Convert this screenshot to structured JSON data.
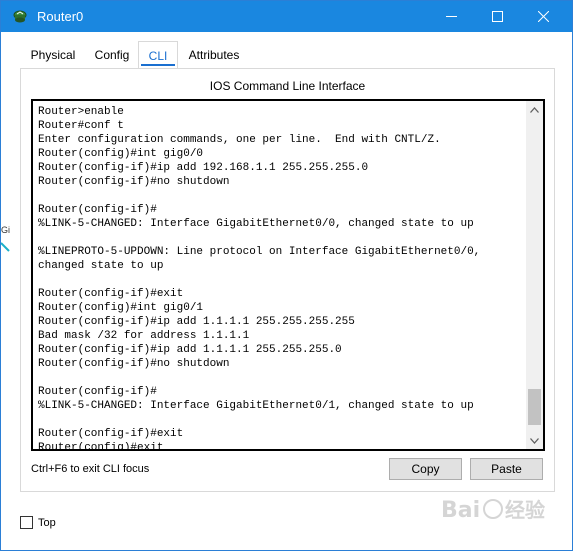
{
  "window": {
    "title": "Router0"
  },
  "tabs": [
    {
      "label": "Physical"
    },
    {
      "label": "Config"
    },
    {
      "label": "CLI"
    },
    {
      "label": "Attributes"
    }
  ],
  "panel": {
    "title": "IOS Command Line Interface"
  },
  "terminal": {
    "lines": [
      "Router>enable",
      "Router#conf t",
      "Enter configuration commands, one per line.  End with CNTL/Z.",
      "Router(config)#int gig0/0",
      "Router(config-if)#ip add 192.168.1.1 255.255.255.0",
      "Router(config-if)#no shutdown",
      "",
      "Router(config-if)#",
      "%LINK-5-CHANGED: Interface GigabitEthernet0/0, changed state to up",
      "",
      "%LINEPROTO-5-UPDOWN: Line protocol on Interface GigabitEthernet0/0,",
      "changed state to up",
      "",
      "Router(config-if)#exit",
      "Router(config)#int gig0/1",
      "Router(config-if)#ip add 1.1.1.1 255.255.255.255",
      "Bad mask /32 for address 1.1.1.1",
      "Router(config-if)#ip add 1.1.1.1 255.255.255.0",
      "Router(config-if)#no shutdown",
      "",
      "Router(config-if)#",
      "%LINK-5-CHANGED: Interface GigabitEthernet0/1, changed state to up",
      "",
      "Router(config-if)#exit",
      "Router(config)#exit"
    ]
  },
  "footer": {
    "hint": "Ctrl+F6 to exit CLI focus",
    "copy_label": "Copy",
    "paste_label": "Paste",
    "top_label": "Top"
  },
  "watermark": {
    "text": "Bai经验"
  },
  "colors": {
    "titlebar": "#1a87e0",
    "active_tab": "#1a6fd0"
  }
}
